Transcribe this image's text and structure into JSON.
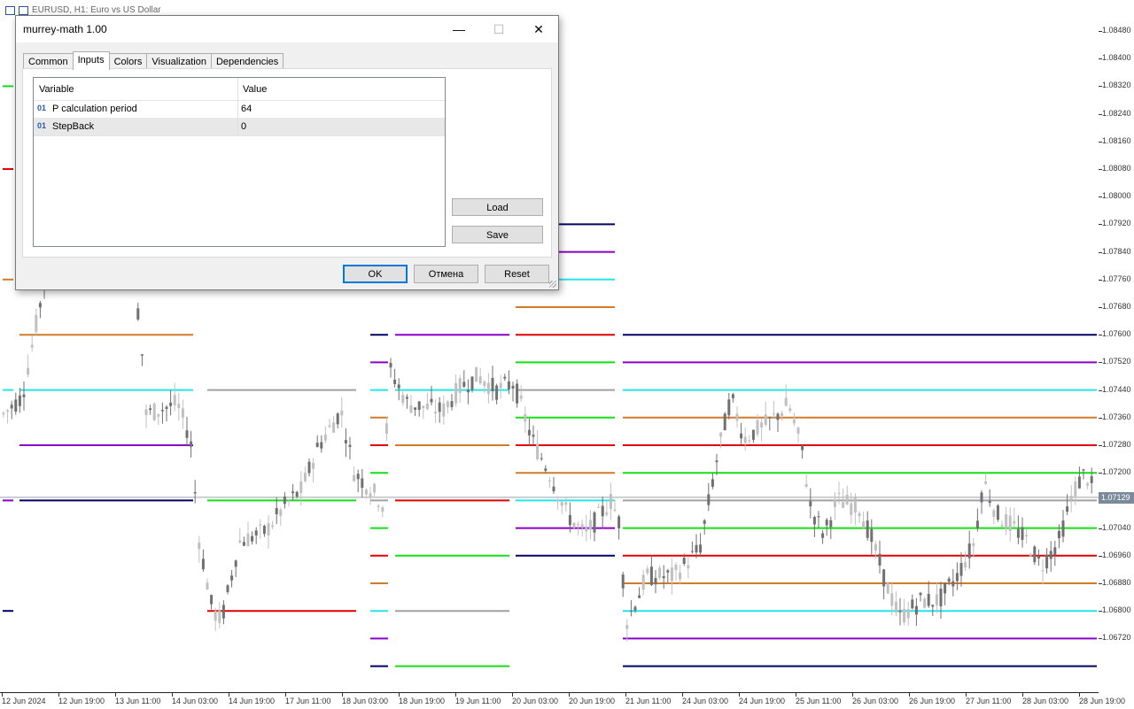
{
  "chart": {
    "header_text": "EURUSD, H1:  Euro vs US Dollar",
    "current_price": "1.07129",
    "price_labels": [
      "1.08480",
      "1.08400",
      "1.08320",
      "1.08240",
      "1.08160",
      "1.08080",
      "1.08000",
      "1.07920",
      "1.07840",
      "1.07760",
      "1.07680",
      "1.07600",
      "1.07520",
      "1.07440",
      "1.07360",
      "1.07280",
      "1.07200",
      "1.07040",
      "1.06960",
      "1.06880",
      "1.06800",
      "1.06720"
    ],
    "time_labels": [
      "12 Jun 2024",
      "12 Jun 19:00",
      "13 Jun 11:00",
      "14 Jun 03:00",
      "14 Jun 19:00",
      "17 Jun 11:00",
      "18 Jun 03:00",
      "18 Jun 19:00",
      "19 Jun 11:00",
      "20 Jun 03:00",
      "20 Jun 19:00",
      "21 Jun 11:00",
      "24 Jun 03:00",
      "24 Jun 19:00",
      "25 Jun 11:00",
      "26 Jun 03:00",
      "26 Jun 19:00",
      "27 Jun 11:00",
      "28 Jun 03:00",
      "28 Jun 19:00"
    ],
    "colors": {
      "navy": "#000066",
      "purple": "#8a00c8",
      "red": "#e00000",
      "orange": "#d07a2a",
      "cyan": "#22e6e6",
      "gray": "#a0a0a0",
      "green": "#12e012",
      "bull": "#c0c0c0",
      "bear": "#707070"
    }
  },
  "dialog": {
    "title": "murrey-math 1.00",
    "window_controls": {
      "minimize": "—",
      "maximize": "☐",
      "close": "✕"
    },
    "tabs": [
      {
        "label": "Common",
        "active": false
      },
      {
        "label": "Inputs",
        "active": true
      },
      {
        "label": "Colors",
        "active": false
      },
      {
        "label": "Visualization",
        "active": false
      },
      {
        "label": "Dependencies",
        "active": false
      }
    ],
    "grid": {
      "col_variable": "Variable",
      "col_value": "Value",
      "rows": [
        {
          "type": "01",
          "name": "P calculation period",
          "value": "64"
        },
        {
          "type": "01",
          "name": "StepBack",
          "value": "0"
        }
      ]
    },
    "buttons": {
      "load": "Load",
      "save": "Save",
      "ok": "OK",
      "cancel": "Отмена",
      "reset": "Reset"
    }
  }
}
